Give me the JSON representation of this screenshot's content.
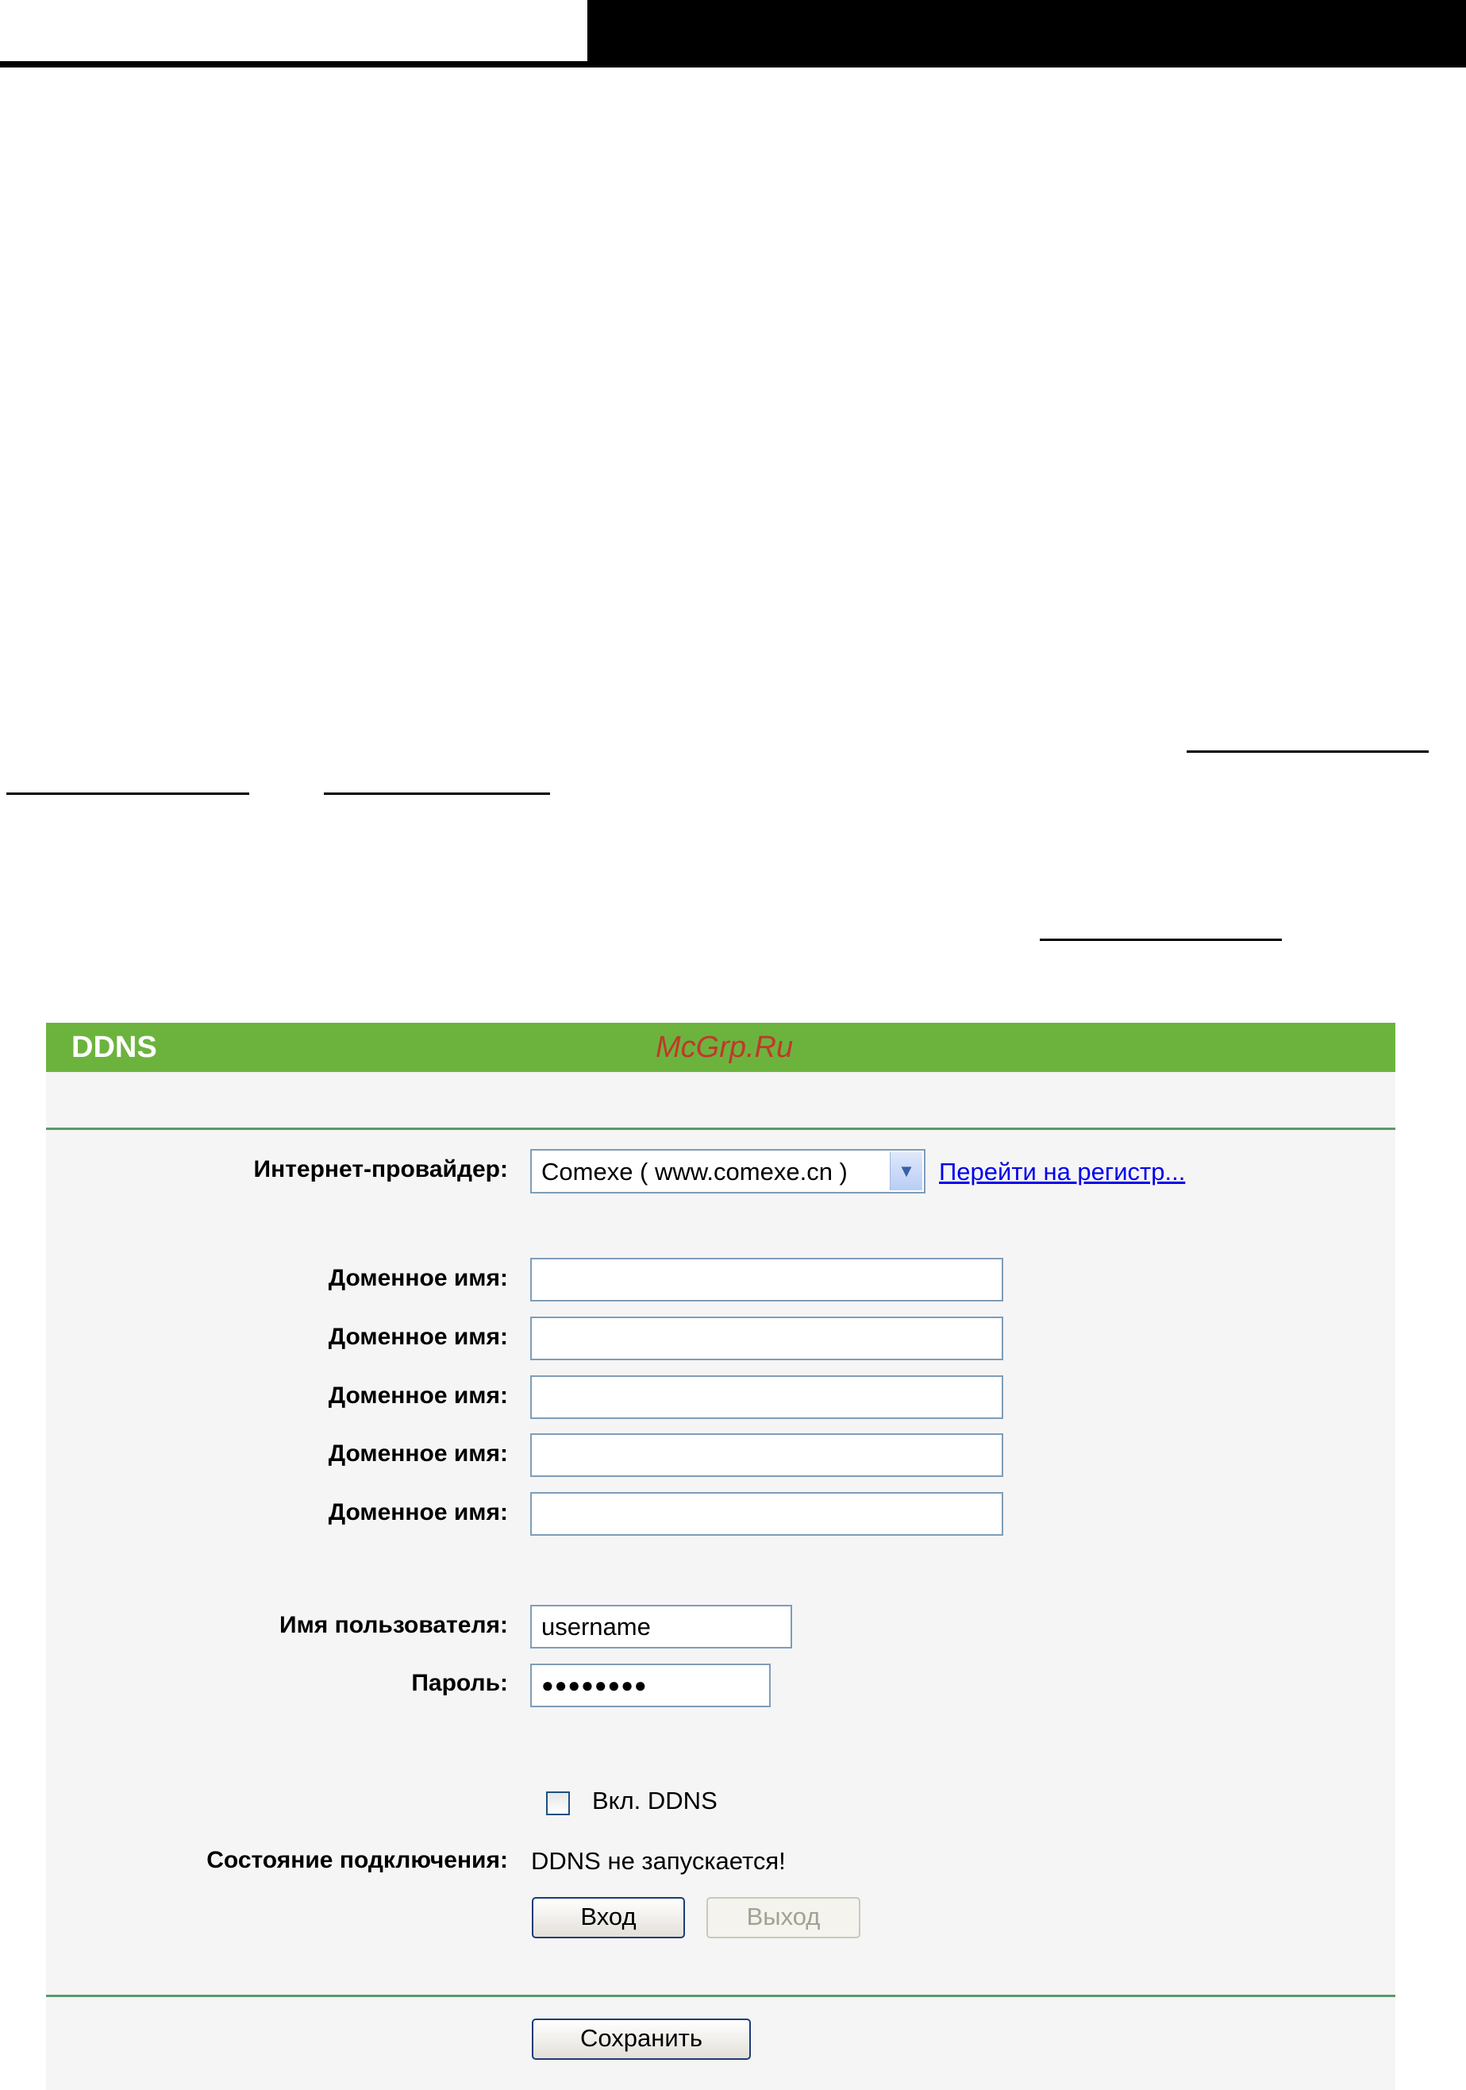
{
  "panel": {
    "title": "DDNS",
    "watermark": "McGrp.Ru"
  },
  "form": {
    "provider_label": "Интернет-провайдер:",
    "provider_value": "Comexe ( www.comexe.cn )",
    "register_link": "Перейти на регистр...",
    "domain_label": "Доменное имя:",
    "domains": [
      "",
      "",
      "",
      "",
      ""
    ],
    "username_label": "Имя пользователя:",
    "username_value": "username",
    "password_label": "Пароль:",
    "password_value": "●●●●●●●●",
    "enable_label": "Вкл. DDNS",
    "enable_checked": false,
    "status_label": "Состояние подключения:",
    "status_value": "DDNS не запускается!",
    "login_button": "Вход",
    "logout_button": "Выход",
    "save_button": "Сохранить"
  },
  "icons": {
    "dropdown": "chevron-down-icon",
    "checkbox": "checkbox-icon"
  },
  "colors": {
    "header_green": "#6cb33e",
    "panel_bg": "#f5f5f5",
    "separator": "#5a9a6a",
    "link": "#0000ee",
    "watermark": "#c0392b"
  }
}
